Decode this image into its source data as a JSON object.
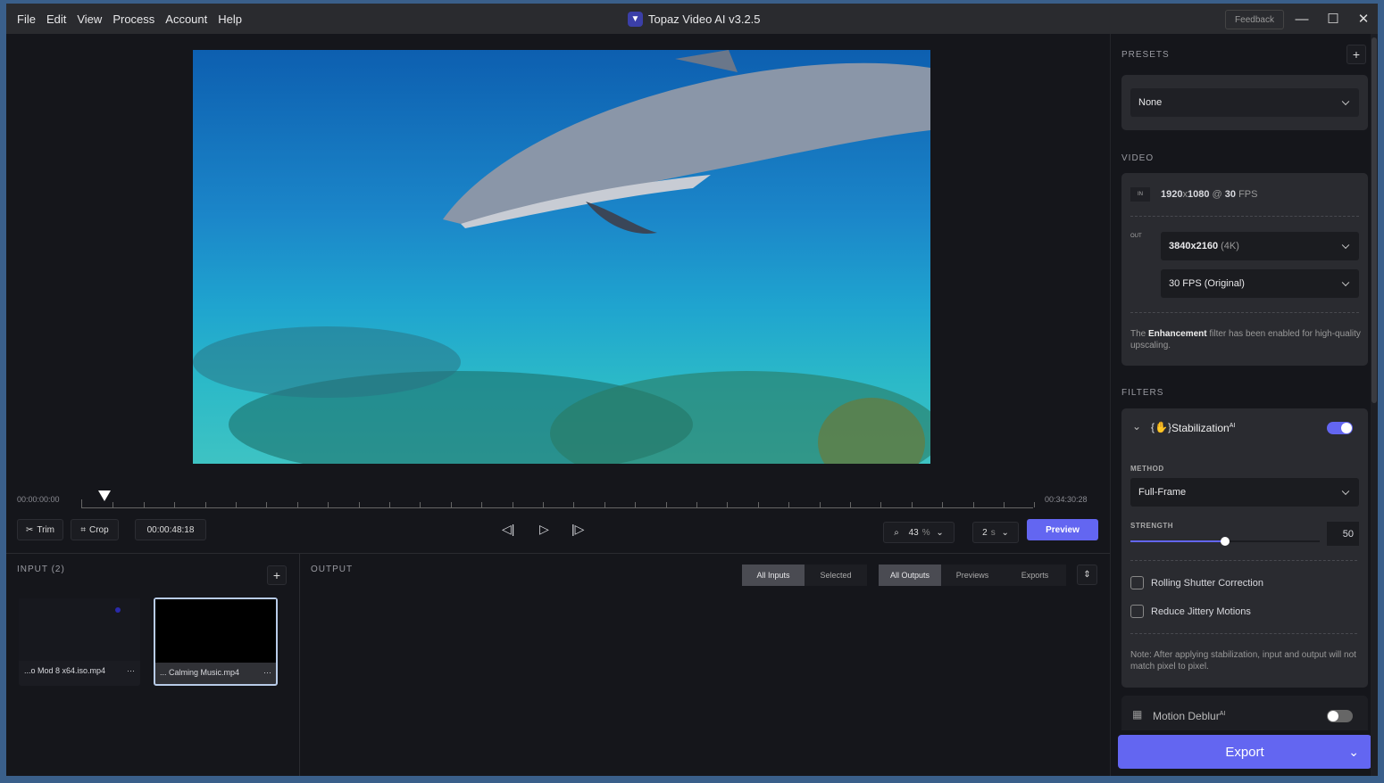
{
  "menu": [
    "File",
    "Edit",
    "View",
    "Process",
    "Account",
    "Help"
  ],
  "title": "Topaz Video AI  v3.2.5",
  "feedback": "Feedback",
  "timeline": {
    "start": "00:00:00:00",
    "end": "00:34:30:28",
    "playhead_fraction": 0.024
  },
  "controls": {
    "trim": "Trim",
    "crop": "Crop",
    "timecode": "00:00:48:18",
    "zoom_value": "43",
    "zoom_unit": "%",
    "duration_value": "2",
    "duration_unit": "s",
    "preview": "Preview"
  },
  "input": {
    "title": "INPUT (2)",
    "files": [
      {
        "name": "...o Mod 8 x64.iso.mp4",
        "selected": false
      },
      {
        "name": "... Calming Music.mp4",
        "selected": true
      }
    ]
  },
  "output": {
    "title": "OUTPUT",
    "filters_a": [
      "All Inputs",
      "Selected"
    ],
    "filters_b": [
      "All Outputs",
      "Previews",
      "Exports"
    ]
  },
  "presets": {
    "title": "PRESETS",
    "value": "None"
  },
  "video": {
    "title": "VIDEO",
    "in_badge": "IN",
    "in_res": "1920",
    "in_res2": "1080",
    "in_at": "@",
    "in_fps": "30",
    "in_fps_unit": "FPS",
    "out_badge": "OUT",
    "out_res": "3840x2160",
    "out_res_note": "(4K)",
    "out_fps": "30 FPS (Original)",
    "note_pre": "The ",
    "note_bold": "Enhancement",
    "note_post": " filter has been enabled for high-quality upscaling."
  },
  "filters": {
    "title": "FILTERS",
    "stabilization": {
      "label": "Stabilization",
      "ai": "AI",
      "enabled": true,
      "method_label": "METHOD",
      "method": "Full-Frame",
      "strength_label": "STRENGTH",
      "strength": "50",
      "strength_max": 100,
      "rolling": "Rolling Shutter Correction",
      "jittery": "Reduce Jittery Motions",
      "note": "Note: After applying stabilization, input and output will not match pixel to pixel."
    },
    "deblur": {
      "label": "Motion Deblur",
      "ai": "AI",
      "enabled": false
    }
  },
  "export": "Export",
  "colors": {
    "accent": "#6366f1"
  }
}
